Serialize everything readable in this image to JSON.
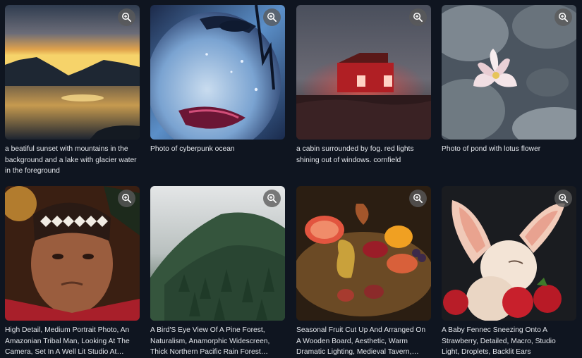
{
  "gallery": {
    "zoom_icon": "zoom-in-icon",
    "items": [
      {
        "caption": "a beatiful sunset with mountains in the background and a lake with glacier water in the foreground"
      },
      {
        "caption": "Photo of cyberpunk ocean"
      },
      {
        "caption": "a cabin surrounded by fog. red lights shining out of windows. cornfield"
      },
      {
        "caption": "Photo of pond with lotus flower"
      },
      {
        "caption": "High Detail, Medium Portrait Photo, An Amazonian Tribal Man, Looking At The Camera, Set In A Well Lit Studio At Gold…"
      },
      {
        "caption": "A Bird'S Eye View Of A Pine Forest, Naturalism, Anamorphic Widescreen, Thick Northern Pacific Rain Forest With…"
      },
      {
        "caption": "Seasonal Fruit Cut Up And Arranged On A Wooden Board, Aesthetic, Warm Dramatic Lighting, Medieval Tavern, Delicious…"
      },
      {
        "caption": "A Baby Fennec Sneezing Onto A Strawberry, Detailed, Macro, Studio Light, Droplets, Backlit Ears"
      }
    ]
  }
}
